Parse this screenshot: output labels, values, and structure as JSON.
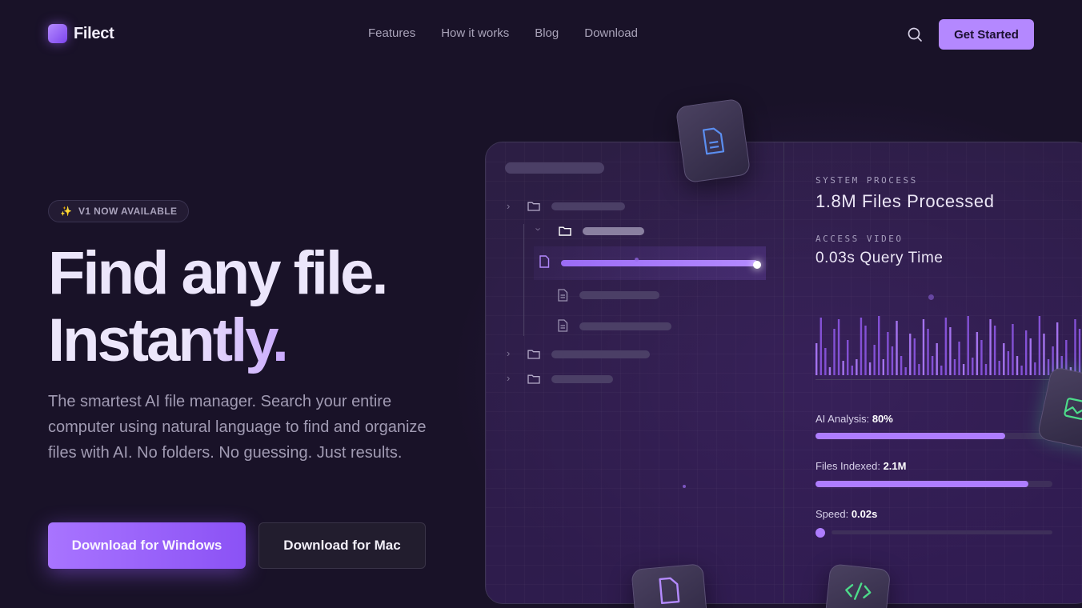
{
  "brand": {
    "name": "Filect"
  },
  "nav": {
    "links": [
      "Features",
      "How it works",
      "Blog",
      "Download"
    ],
    "cta": "Get Started"
  },
  "hero": {
    "badge": "V1 NOW AVAILABLE",
    "title_line1": "Find any file.",
    "title_line2": "Instantly.",
    "subtitle": "The smartest AI file manager. Search your entire computer using natural language to find and organize files with AI. No folders. No guessing. Just results.",
    "btn_windows": "Download for Windows",
    "btn_mac": "Download for Mac"
  },
  "panel": {
    "stat1_label": "SYSTEM PROCESS",
    "stat1_value": "1.8M Files Processed",
    "stat2_label": "ACCESS VIDEO",
    "stat2_value": "0.03s Query Time",
    "metrics": [
      {
        "label": "AI Analysis:",
        "value": "80%",
        "progress": 0.8
      },
      {
        "label": "Files Indexed:",
        "value": "2.1M",
        "progress": 0.9
      },
      {
        "label": "Speed:",
        "value": "0.02s"
      }
    ]
  },
  "icons": {
    "search": "search-icon",
    "sparkle": "sparkle-icon",
    "folder": "folder-icon",
    "file": "file-icon",
    "image": "image-icon",
    "code": "code-icon"
  },
  "colors": {
    "background": "#191228",
    "accent": "#b488ff",
    "accent_dark": "#8b52f5",
    "doc_icon": "#5b8ef0",
    "code_icon": "#4ddc8a"
  }
}
